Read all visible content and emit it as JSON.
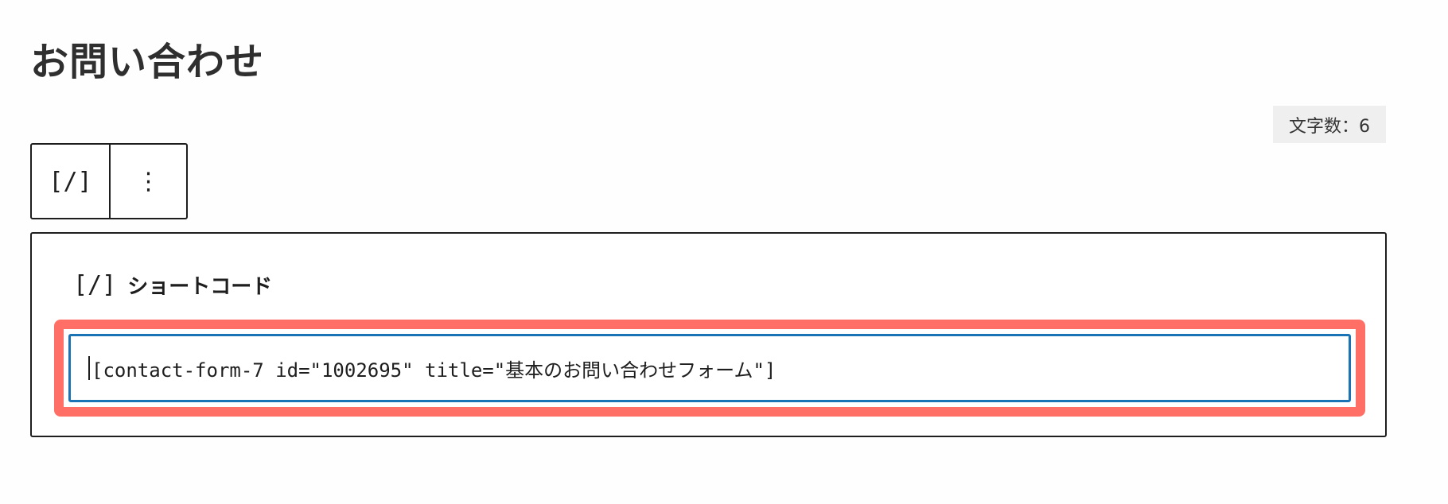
{
  "page": {
    "title": "お問い合わせ"
  },
  "editor": {
    "char_count": "文字数：6"
  },
  "toolbar": {
    "block_type_label": "[/]",
    "options_label": "⋮"
  },
  "block": {
    "icon_label": "[/]",
    "label": "ショートコード",
    "shortcode_value": "[contact-form-7 id=\"1002695\" title=\"基本のお問い合わせフォーム\"]"
  },
  "colors": {
    "highlight": "#ff6f66",
    "focus_border": "#1a73b4",
    "count_bg": "#efefef"
  },
  "icons": {
    "block_type": "shortcode-icon",
    "options": "vertical-ellipsis-icon"
  }
}
